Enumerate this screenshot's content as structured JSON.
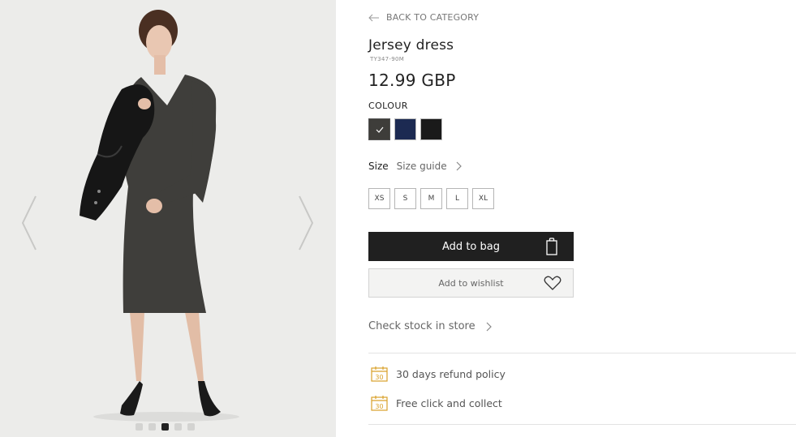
{
  "navigation": {
    "back_label": "BACK TO CATEGORY"
  },
  "product": {
    "title": "Jersey dress",
    "sku": "TY347-90M",
    "price": "12.99 GBP"
  },
  "colour": {
    "label": "COLOUR",
    "swatches": [
      {
        "name": "dark-grey-melange",
        "color": "#3e3d3a",
        "selected": true
      },
      {
        "name": "navy",
        "color": "#1c2a52",
        "selected": false
      },
      {
        "name": "black",
        "color": "#1a1a1a",
        "selected": false
      }
    ]
  },
  "size": {
    "label": "Size",
    "guide_label": "Size guide",
    "options": [
      "XS",
      "S",
      "M",
      "L",
      "XL"
    ]
  },
  "actions": {
    "add_to_bag": "Add to bag",
    "add_to_wishlist": "Add to wishlist",
    "check_stock": "Check stock in store"
  },
  "benefits": [
    {
      "label": "30 days refund policy",
      "icon": "calendar-30-icon"
    },
    {
      "label": "Free click and collect",
      "icon": "calendar-30-icon"
    }
  ],
  "gallery": {
    "image_count": 5,
    "active_index": 2
  },
  "colors": {
    "accent_icon": "#d9a12a",
    "button_dark": "#202020"
  }
}
